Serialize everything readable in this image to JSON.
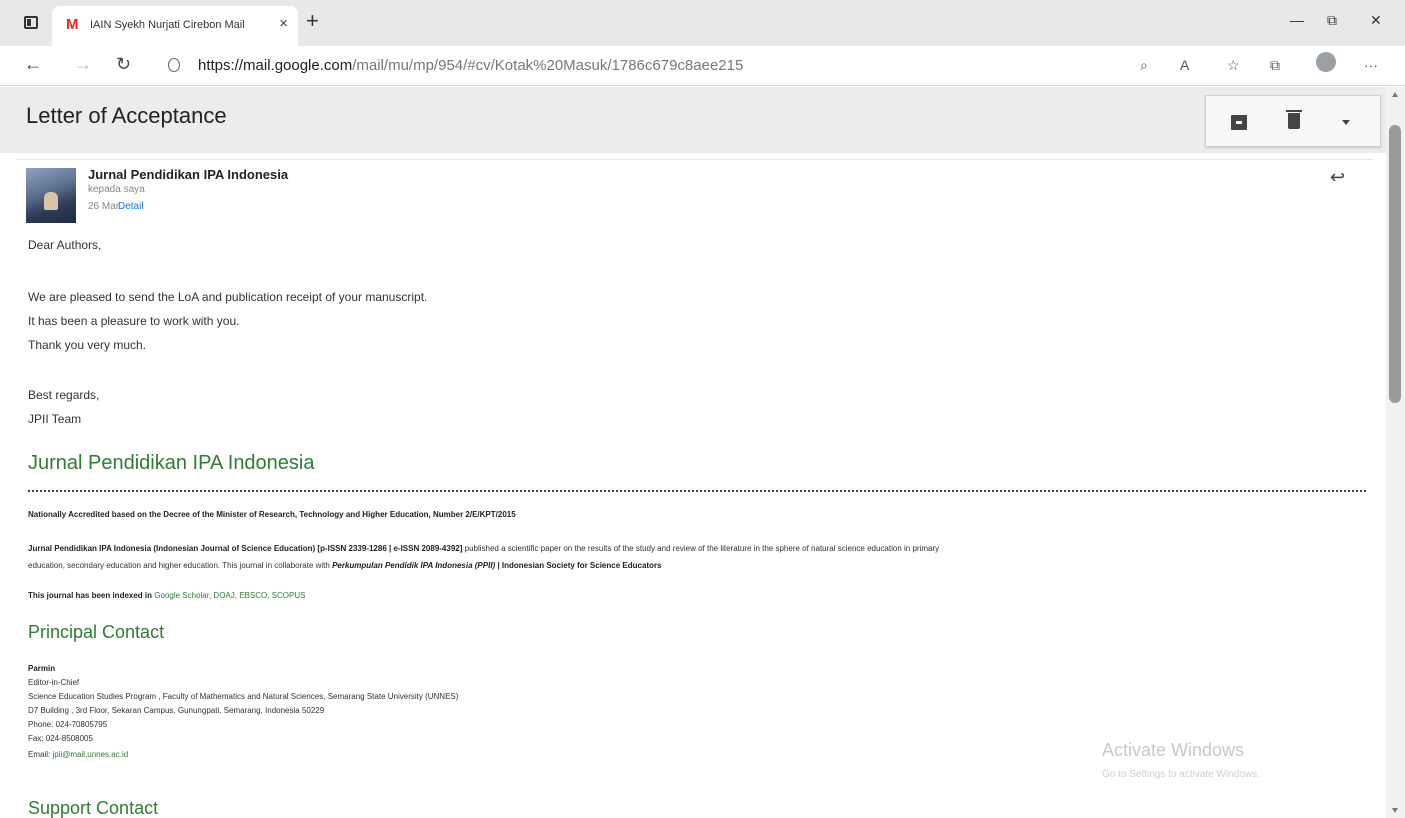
{
  "browser": {
    "tab_title": "IAIN Syekh Nurjati Cirebon Mail",
    "tab_favicon": "M",
    "url_host": "https://mail.google.com",
    "url_path": "/mail/mu/mp/954/#cv/Kotak%20Masuk/1786c679c8aee215",
    "icons": [
      "sidebar-icon",
      "gmail-favicon",
      "close-icon",
      "new-tab-icon",
      "minimize-icon",
      "maximize-icon",
      "close-window-icon",
      "back-icon",
      "forward-icon",
      "refresh-icon",
      "lock-icon",
      "search-icon",
      "read-aloud-icon",
      "favorites-icon",
      "collections-icon",
      "profile-icon",
      "more-icon"
    ]
  },
  "email": {
    "subject": "Letter of Acceptance",
    "sender": "Jurnal Pendidikan IPA Indonesia",
    "to": "kepada saya",
    "date": "26 Mar",
    "detail_link": "Detail",
    "body": {
      "greeting": "Dear Authors,",
      "line1": "We are pleased to send the LoA and publication receipt of your manuscript.",
      "line2": "It has been a pleasure to work with you.",
      "line3": "Thank you very much.",
      "closing": "Best regards,",
      "signature": "JPII Team"
    },
    "footer": {
      "journal_title": "Jurnal Pendidikan IPA Indonesia",
      "accreditation": "Nationally Accredited based on the Decree of the Minister of Research, Technology and Higher Education, Number 2/E/KPT/2015",
      "desc_bold": "Jurnal Pendidikan IPA Indonesia (Indonesian Journal of Science Education)",
      "desc_issn": "[p-ISSN 2339-1286 | e-ISSN 2089-4392]",
      "desc_rest": "published a scientific paper on the results of the study and review of the literature in the sphere of natural science education in primary",
      "desc_line2_a": "education, secondary education and higher education. This journal in collaborate with",
      "desc_line2_b": "Perkumpulan Pendidik IPA Indonesia (PPII)",
      "desc_line2_c": "| Indonesian Society for Science Educators",
      "indexed_prefix": "This journal has been indexed in",
      "indexed_list": "Google Scholar, DOAJ, EBSCO, SCOPUS",
      "principal_heading": "Principal Contact",
      "principal_name": "Parmin",
      "principal_role": "Editor-in-Chief",
      "principal_affil": "Science Education Studies Program , Faculty of Mathematics and Natural Sciences, Semarang State University (UNNES)",
      "principal_address": "D7 Building , 3rd Floor, Sekaran Campus, Gunungpati, Semarang, Indonesia 50229",
      "principal_phone": "Phone: 024-70805795",
      "principal_fax": "Fax: 024-8508005",
      "principal_email_prefix": "Email:",
      "principal_email": "jpii@mail.unnes.ac.id",
      "support_heading": "Support Contact"
    }
  },
  "watermark": {
    "line1": "Activate Windows",
    "line2": "Go to Settings to activate Windows."
  }
}
